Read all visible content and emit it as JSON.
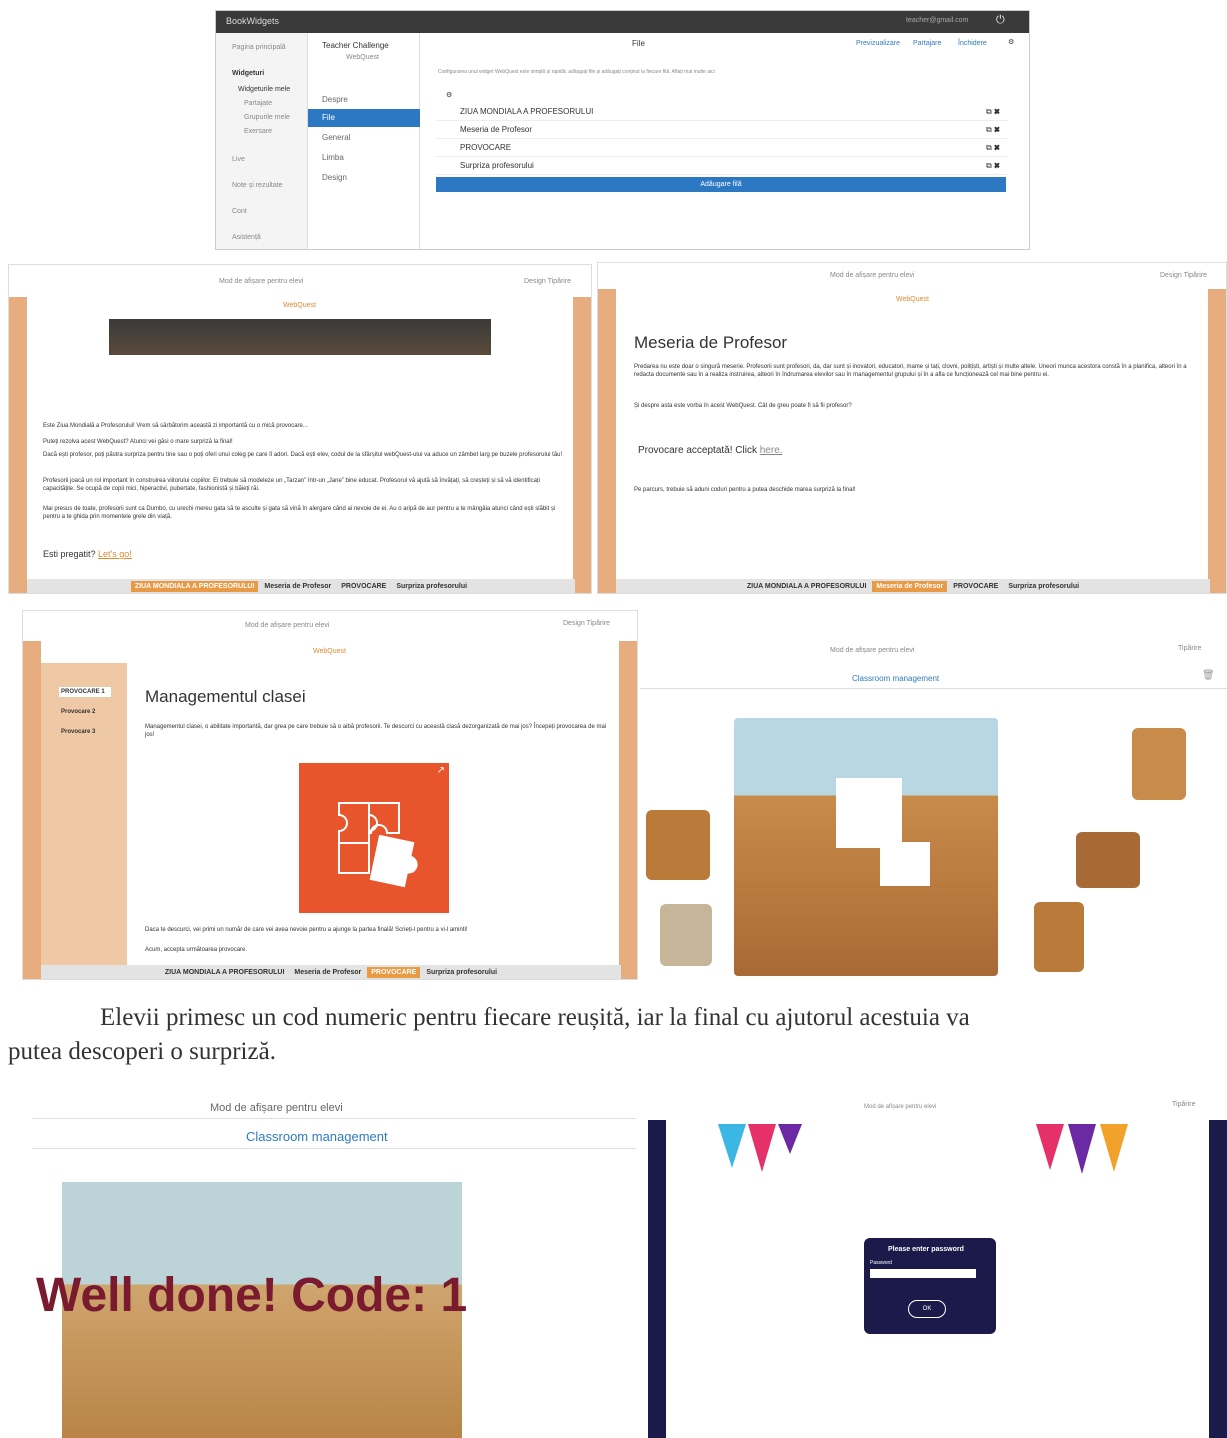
{
  "screen1": {
    "logo": "BookWidgets",
    "user_email": "teacher@gmail.com",
    "sidebar": [
      "Pagina principală",
      "Widgeturi",
      "Widgeturile mele",
      "Partajate",
      "Grupurile mele",
      "Exersare",
      "Live",
      "Note și rezultate",
      "Cont",
      "Asistență"
    ],
    "widget_title": "Teacher Challenge",
    "widget_subtitle": "WebQuest",
    "menu": [
      "Despre",
      "File",
      "General",
      "Limba",
      "Design"
    ],
    "header_center": "File",
    "header_links": [
      "Previzualizare",
      "Partajare",
      "Închidere"
    ],
    "info_text": "Configurarea unui widget WebQuest este simplă și rapidă: adăugați file și adăugați conținut la fiecare filă. Aflați mai multe aici",
    "files": [
      "ZIUA MONDIALA A PROFESORULUI",
      "Meseria de Profesor",
      "PROVOCARE",
      "Surpriza profesorului"
    ],
    "add_button": "Adăugare filă"
  },
  "screen2": {
    "mode_label": "Mod de afișare pentru elevi",
    "toplinks": "Design  Tipărire",
    "banner": "WebQuest",
    "paragraphs": [
      "Este Ziua Mondială a Profesorului! Vrem să sărbătorim această zi importantă cu o mică provocare...",
      "Puteți rezolva acest WebQuest? Atunci vei găsi o mare surpriză la final!",
      "Dacă ești profesor, poți păstra surpriza pentru tine sau o poți oferi unui coleg pe care îl adori. Dacă ești elev, codul de la sfârșitul webQuest-ului va aduce un zâmbet larg pe buzele profesorului tău!",
      "Profesorii joacă un rol important în construirea viitorului copiilor. Ei trebuie să modeleze un „Tarzan” într-un „Jane” bine educat. Profesorul vă ajută să învățați, să creșteți și să vă identificați capacitățile. Se ocupă de copii mici, hiperactivi, pubertate, fashionistă și băieți răi.",
      "Mai presus de toate, profesorii sunt ca Dumbo, cu urechi mereu gata să te asculte și gata să vină în alergare când ai nevoie de ei. Au o aripă de aur pentru a te mângâia atunci când ești slăbit și pentru a te ghida prin momentele grele din viață."
    ],
    "ready": "Esti pregatit?",
    "ready_link": "Let's go!",
    "tabs": [
      "ZIUA MONDIALA A PROFESORULUI",
      "Meseria de Profesor",
      "PROVOCARE",
      "Surpriza profesorului"
    ]
  },
  "screen3": {
    "mode_label": "Mod de afișare pentru elevi",
    "toplinks": "Design  Tipărire",
    "banner": "WebQuest",
    "title": "Meseria de Profesor",
    "paragraph": "Predarea nu este doar o singură meserie. Profesorii sunt profesori, da, dar sunt și inovatori, educatori, mame și tați, clovni, polițiști, artiști și multe altele. Uneori munca acestora constă în a planifica, alteori în a redacta documente sau în a realiza instruirea, alteori în îndrumarea elevilor sau în managementul grupului și în a afla ce funcționează cel mai bine pentru ei.",
    "question": "Și despre asta este vorba în acest WebQuest. Cât de greu poate fi să fii profesor?",
    "challenge": "Provocare acceptată! Click",
    "challenge_link": "here.",
    "note": "Pe parcurs, trebuie să aduni coduri pentru a putea deschide marea surpriză la final!",
    "tabs": [
      "ZIUA MONDIALA A PROFESORULUI",
      "Meseria de Profesor",
      "PROVOCARE",
      "Surpriza profesorului"
    ]
  },
  "screen4": {
    "mode_label": "Mod de afișare pentru elevi",
    "toplinks": "Design  Tipărire",
    "banner": "WebQuest",
    "subnav": [
      "PROVOCARE 1",
      "Provocare 2",
      "Provocare 3"
    ],
    "title": "Managementul clasei",
    "paragraph": "Managementul clasei, o abilitate importantă, dar grea pe care trebuie să o aibă profesorii. Te descurci cu această clasă dezorganizată de mai jos? Începeți provocarea de mai jos!",
    "bottom1": "Daca te descurci, vei primi un număr de care vei avea nevoie pentru a ajunge la partea finală! Scrieți-l pentru a vi-l aminti!",
    "bottom2": "Acum, accepta următoarea provocare.",
    "tabs": [
      "ZIUA MONDIALA A PROFESORULUI",
      "Meseria de Profesor",
      "PROVOCARE",
      "Surpriza profesorului"
    ]
  },
  "screen5": {
    "mode_label": "Mod de afișare pentru elevi",
    "toplinks": "Tipărire",
    "title": "Classroom management"
  },
  "caption": {
    "line1": "Elevii primesc un cod numeric pentru fiecare reușită, iar la final cu ajutorul acestuia va",
    "line2": "putea descoperi o surpriză."
  },
  "screen6": {
    "mode_label": "Mod de afișare pentru elevi",
    "title": "Classroom management",
    "overlay": "Well done! Code: 1"
  },
  "screen7": {
    "mode_label": "Mod de afișare pentru elevi",
    "toplinks": "Tipărire",
    "dialog_title": "Please enter password",
    "password_label": "Password",
    "ok": "OK"
  }
}
